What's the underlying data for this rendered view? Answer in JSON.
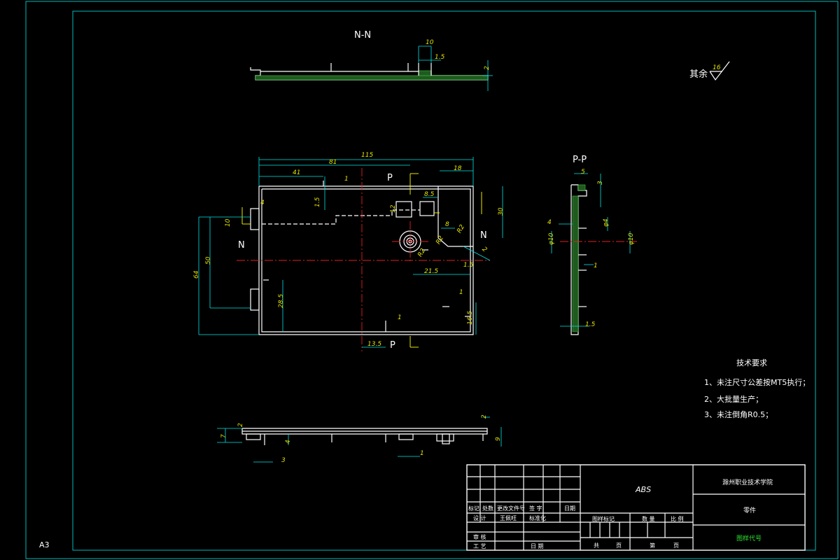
{
  "views": {
    "nn_label": "N-N",
    "pp_label": "P-P",
    "section_marks": {
      "p_top": "P",
      "p_bottom": "P",
      "n_left": "N",
      "n_right": "N"
    }
  },
  "dimensions": {
    "nn": [
      "10",
      "1.5",
      "2"
    ],
    "main_top": [
      "115",
      "81",
      "41",
      "18",
      "1"
    ],
    "main_left": [
      "4",
      "10",
      "1.5",
      "50",
      "64",
      "28.5"
    ],
    "main_inner": [
      "8.5",
      "12",
      "8",
      "R2",
      "R2",
      "R2",
      "2"
    ],
    "main_right": [
      "30",
      "1.5",
      "21.5",
      "1",
      "16.5"
    ],
    "main_bottom": [
      "1",
      "13.5"
    ],
    "pp": [
      "5",
      "3",
      "4",
      "φ4",
      "φ10",
      "φ10",
      "1",
      "1.5"
    ],
    "bottom_view": [
      "2",
      "7",
      "4",
      "3",
      "1",
      "9",
      "2"
    ]
  },
  "surface_finish": {
    "text": "其余",
    "value": "16"
  },
  "tech_requirements": {
    "title": "技术要求",
    "items": [
      "1、未注尺寸公差按MT5执行；",
      "2、大批量生产；",
      "3、未注倒角R0.5；"
    ]
  },
  "sheet_size": "A3",
  "title_block": {
    "material": "ABS",
    "school": "滁州职业技术学院",
    "part": "零件",
    "drawing_code": "图样代号",
    "rev_headers": [
      "标记",
      "处数",
      "更改文件号",
      "签 字",
      "日期"
    ],
    "row_design": [
      "设 计",
      "王佩旺",
      "标准化"
    ],
    "row_check": "审 核",
    "row_process": "工 艺",
    "row_date": "日 期",
    "stage_headers": [
      "图样标记",
      "数 量",
      "比 例"
    ],
    "sheets": [
      "共",
      "页",
      "第",
      "页"
    ]
  }
}
